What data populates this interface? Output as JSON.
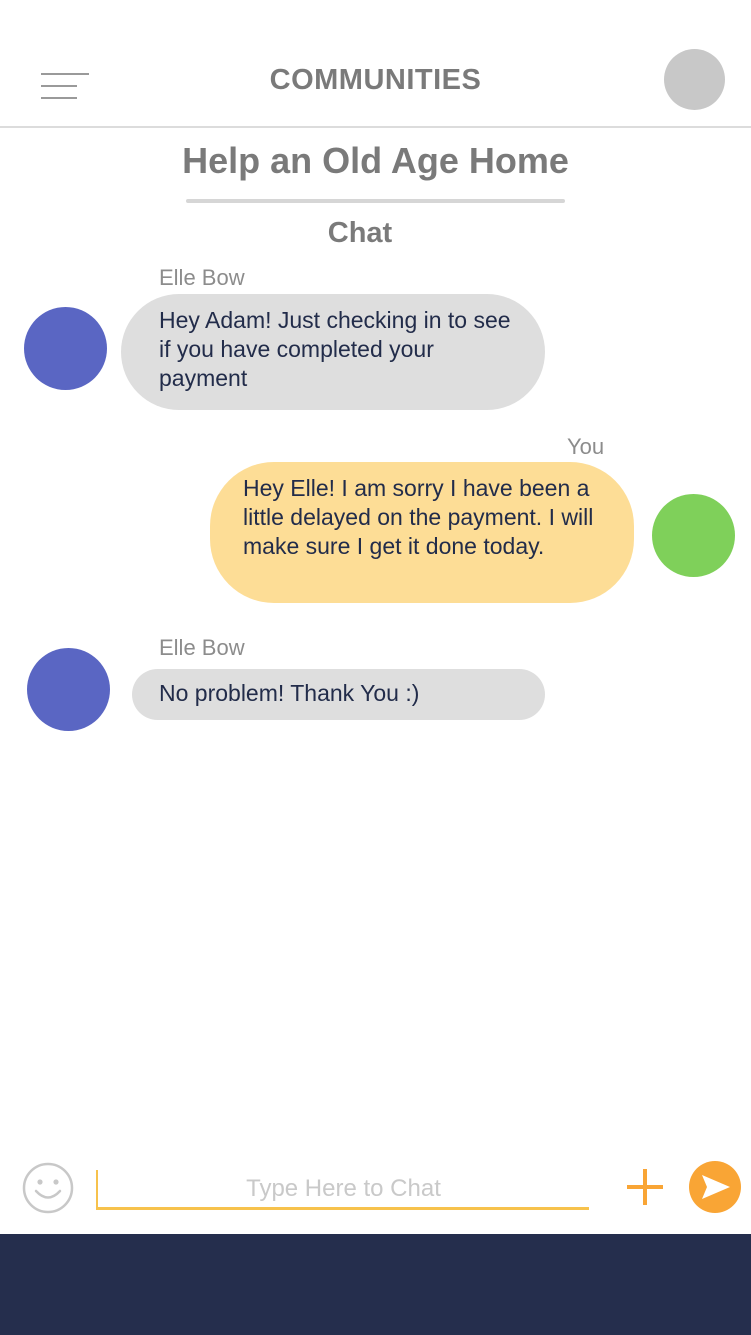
{
  "header": {
    "title": "COMMUNITIES",
    "menu_icon": "hamburger-menu-icon",
    "profile_icon": "profile-avatar"
  },
  "community": {
    "title": "Help an Old Age Home",
    "section": "Chat"
  },
  "messages": [
    {
      "sender": "Elle Bow",
      "text": "Hey Adam! Just checking in to see if you have completed your payment",
      "from_self": false,
      "avatar_color": "#5a66c3"
    },
    {
      "sender": "You",
      "text": "Hey Elle! I am sorry I have been a little delayed on the payment. I will make sure I get it done today.",
      "from_self": true,
      "avatar_color": "#7fd05a"
    },
    {
      "sender": "Elle Bow",
      "text": "No problem! Thank You :)",
      "from_self": false,
      "avatar_color": "#5a66c3"
    }
  ],
  "input": {
    "placeholder": "Type Here to Chat",
    "value": "",
    "emoji_icon": "smiley-icon",
    "attach_icon": "plus-icon",
    "send_icon": "send-icon"
  },
  "colors": {
    "accent": "#f9a535",
    "incoming_bubble": "#dedede",
    "outgoing_bubble": "#fddd96",
    "footer": "#252e4d",
    "title_gray": "#7a7a7a",
    "text_navy": "#222c4a"
  }
}
